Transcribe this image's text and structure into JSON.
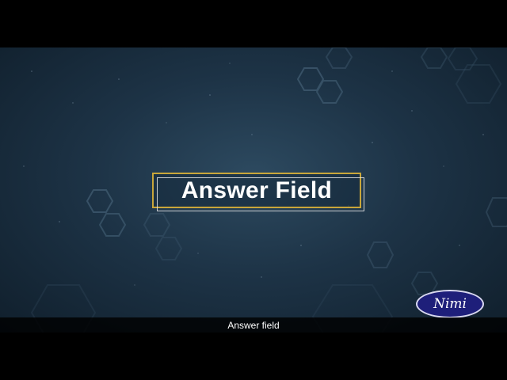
{
  "slide": {
    "title": "Answer Field",
    "caption": "Answer field",
    "logo_text": "Nimi"
  },
  "colors": {
    "background": "#1d3346",
    "title_border": "#c9a63a",
    "hexagon_stroke": "#4e6b82",
    "logo_fill": "#1e1f7a",
    "caption_bar": "#000000"
  }
}
